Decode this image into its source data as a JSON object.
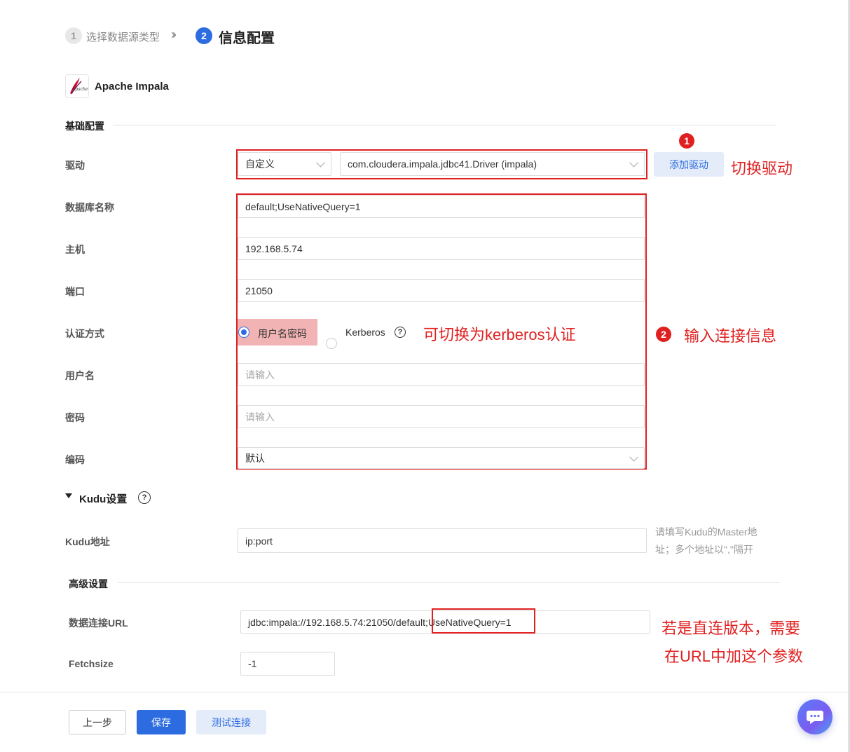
{
  "steps": [
    {
      "num": "1",
      "label": "选择数据源类型"
    },
    {
      "num": "2",
      "label": "信息配置"
    }
  ],
  "datasource": {
    "name": "Apache Impala",
    "logo_text": "Apache"
  },
  "basic": {
    "title": "基础配置",
    "driver": {
      "label": "驱动",
      "type": "自定义",
      "class": "com.cloudera.impala.jdbc41.Driver (impala)",
      "add_button": "添加驱动"
    },
    "database": {
      "label": "数据库名称",
      "value": "default;UseNativeQuery=1"
    },
    "host": {
      "label": "主机",
      "value": "192.168.5.74"
    },
    "port": {
      "label": "端口",
      "value": "21050"
    },
    "auth": {
      "label": "认证方式",
      "option1": "用户名密码",
      "option2": "Kerberos",
      "selected": "用户名密码"
    },
    "username": {
      "label": "用户名",
      "placeholder": "请输入"
    },
    "password": {
      "label": "密码",
      "placeholder": "请输入"
    },
    "encoding": {
      "label": "编码",
      "value": "默认"
    }
  },
  "kudu": {
    "title": "Kudu设置",
    "address": {
      "label": "Kudu地址",
      "value": "ip:port",
      "hint_line1": "请填写Kudu的Master地",
      "hint_line2": "址；多个地址以\",\"隔开"
    }
  },
  "advanced": {
    "title": "高级设置",
    "url": {
      "label": "数据连接URL",
      "value_prefix": "jdbc:impala://192.168.5.74:21050/defau",
      "value_suffix": "lt;UseNativeQuery=1"
    },
    "fetchsize": {
      "label": "Fetchsize",
      "value": "-1"
    }
  },
  "annotations": {
    "badge1": "1",
    "badge2": "2",
    "switch_driver": "切换驱动",
    "switch_kerberos": "可切换为kerberos认证",
    "input_info": "输入连接信息",
    "direct_line1": "若是直连版本，需要",
    "direct_line2": "在URL中加这个参数"
  },
  "footer": {
    "prev": "上一步",
    "save": "保存",
    "test": "测试连接"
  },
  "colors": {
    "primary": "#2d6ce0",
    "annotation": "#e02020"
  }
}
